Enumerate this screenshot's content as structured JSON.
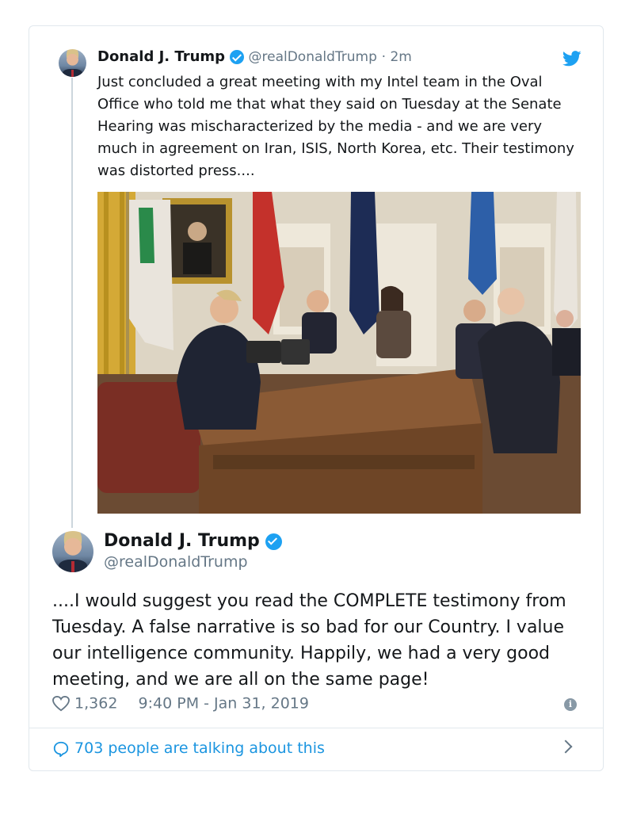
{
  "tweet1": {
    "name": "Donald J. Trump",
    "handle": "@realDonaldTrump",
    "time": "· 2m",
    "text": "Just concluded a great meeting with my Intel team in the Oval Office who told me that what they said on Tuesday at the Senate Hearing was mischaracterized by the media - and we are very much in agreement on Iran, ISIS, North Korea, etc. Their testimony was distorted press...."
  },
  "tweet2": {
    "name": "Donald J. Trump",
    "handle": "@realDonaldTrump",
    "text": "....I would suggest you read the COMPLETE testimony from Tuesday. A false narrative is so bad for our Country. I value our intelligence community. Happily, we had a very good meeting, and we are all on the same page!",
    "likes": "1,362",
    "timestamp": "9:40 PM - Jan 31, 2019"
  },
  "footer": {
    "talking": "703 people are talking about this"
  },
  "colors": {
    "accent": "#1da1f2",
    "link": "#1b95e0",
    "muted": "#657786"
  }
}
